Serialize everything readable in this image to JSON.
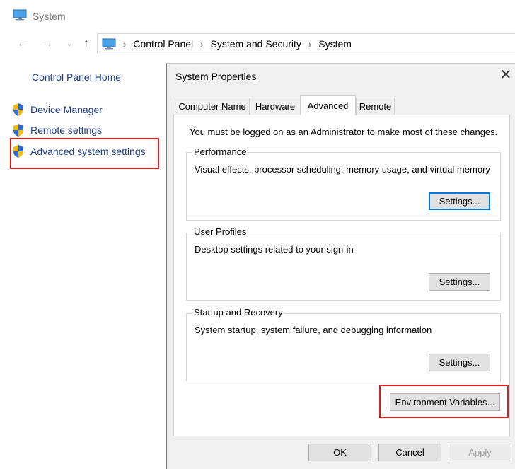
{
  "window": {
    "title": "System"
  },
  "address_bar": {
    "crumbs": [
      "Control Panel",
      "System and Security",
      "System"
    ]
  },
  "left_pane": {
    "home": "Control Panel Home",
    "items": [
      "Device Manager",
      "Remote settings",
      "Advanced system settings"
    ]
  },
  "dialog": {
    "title": "System Properties",
    "close": "✕",
    "tabs": [
      "Computer Name",
      "Hardware",
      "Advanced",
      "Remote"
    ],
    "active_tab": "Advanced",
    "admin_note": "You must be logged on as an Administrator to make most of these changes.",
    "groups": [
      {
        "label": "Performance",
        "description": "Visual effects, processor scheduling, memory usage, and virtual memory",
        "button": "Settings..."
      },
      {
        "label": "User Profiles",
        "description": "Desktop settings related to your sign-in",
        "button": "Settings..."
      },
      {
        "label": "Startup and Recovery",
        "description": "System startup, system failure, and debugging information",
        "button": "Settings..."
      }
    ],
    "env_button": "Environment Variables...",
    "footer": {
      "ok": "OK",
      "cancel": "Cancel",
      "apply": "Apply"
    }
  },
  "colors": {
    "link": "#1e3a8a",
    "highlight": "#e01e1e",
    "focus": "#0078d7"
  }
}
